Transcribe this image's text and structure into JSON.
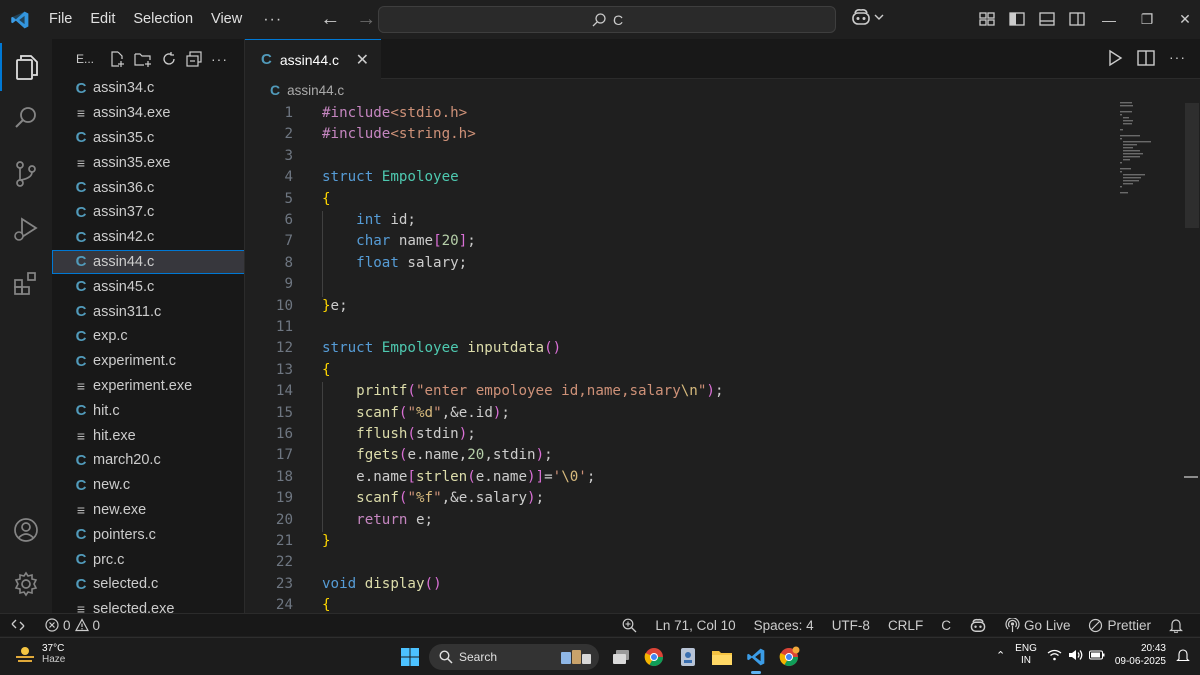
{
  "titlebar": {
    "menus": [
      "File",
      "Edit",
      "Selection",
      "View"
    ],
    "more": "···",
    "search_text": "C"
  },
  "explorer": {
    "title": "E...",
    "files": [
      {
        "name": "assin34.c",
        "type": "c"
      },
      {
        "name": "assin34.exe",
        "type": "exe"
      },
      {
        "name": "assin35.c",
        "type": "c"
      },
      {
        "name": "assin35.exe",
        "type": "exe"
      },
      {
        "name": "assin36.c",
        "type": "c"
      },
      {
        "name": "assin37.c",
        "type": "c"
      },
      {
        "name": "assin42.c",
        "type": "c"
      },
      {
        "name": "assin44.c",
        "type": "c",
        "selected": true
      },
      {
        "name": "assin45.c",
        "type": "c"
      },
      {
        "name": "assin311.c",
        "type": "c"
      },
      {
        "name": "exp.c",
        "type": "c"
      },
      {
        "name": "experiment.c",
        "type": "c"
      },
      {
        "name": "experiment.exe",
        "type": "exe"
      },
      {
        "name": "hit.c",
        "type": "c"
      },
      {
        "name": "hit.exe",
        "type": "exe"
      },
      {
        "name": "march20.c",
        "type": "c"
      },
      {
        "name": "new.c",
        "type": "c"
      },
      {
        "name": "new.exe",
        "type": "exe"
      },
      {
        "name": "pointers.c",
        "type": "c"
      },
      {
        "name": "prc.c",
        "type": "c"
      },
      {
        "name": "selected.c",
        "type": "c"
      },
      {
        "name": "selected.exe",
        "type": "exe"
      }
    ]
  },
  "editor": {
    "tab_label": "assin44.c",
    "breadcrumb": "assin44.c",
    "file_icon_letter": "C",
    "lines": [
      {
        "n": "1",
        "code": "#include<stdio.h>"
      },
      {
        "n": "2",
        "code": "#include<string.h>"
      },
      {
        "n": "3",
        "code": ""
      },
      {
        "n": "4",
        "code": "struct Empoloyee"
      },
      {
        "n": "5",
        "code": "{"
      },
      {
        "n": "6",
        "code": "    int id;"
      },
      {
        "n": "7",
        "code": "    char name[20];"
      },
      {
        "n": "8",
        "code": "    float salary;"
      },
      {
        "n": "9",
        "code": ""
      },
      {
        "n": "10",
        "code": "}e;"
      },
      {
        "n": "11",
        "code": ""
      },
      {
        "n": "12",
        "code": "struct Empoloyee inputdata()"
      },
      {
        "n": "13",
        "code": "{"
      },
      {
        "n": "14",
        "code": "    printf(\"enter empoloyee id,name,salary\\n\");"
      },
      {
        "n": "15",
        "code": "    scanf(\"%d\",&e.id);"
      },
      {
        "n": "16",
        "code": "    fflush(stdin);"
      },
      {
        "n": "17",
        "code": "    fgets(e.name,20,stdin);"
      },
      {
        "n": "18",
        "code": "    e.name[strlen(e.name)]='\\0';"
      },
      {
        "n": "19",
        "code": "    scanf(\"%f\",&e.salary);"
      },
      {
        "n": "20",
        "code": "    return e;"
      },
      {
        "n": "21",
        "code": "}"
      },
      {
        "n": "22",
        "code": ""
      },
      {
        "n": "23",
        "code": "void display()"
      },
      {
        "n": "24",
        "code": "{"
      }
    ]
  },
  "statusbar": {
    "errors": "0",
    "warnings": "0",
    "cursor": "Ln 71, Col 10",
    "spaces": "Spaces: 4",
    "encoding": "UTF-8",
    "eol": "CRLF",
    "language": "C",
    "golive": "Go Live",
    "prettier": "Prettier"
  },
  "taskbar": {
    "temp": "37°C",
    "weather": "Haze",
    "search": "Search",
    "lang_1": "ENG",
    "lang_2": "IN",
    "time": "20:43",
    "date": "09-06-2025"
  },
  "colors": {
    "accent": "#0078d4",
    "keyword": "#569cd6",
    "control": "#c586c0",
    "function": "#dcdcaa",
    "string": "#ce9178",
    "number": "#b5cea8",
    "type": "#4ec9b0",
    "escape": "#d7ba7d"
  }
}
